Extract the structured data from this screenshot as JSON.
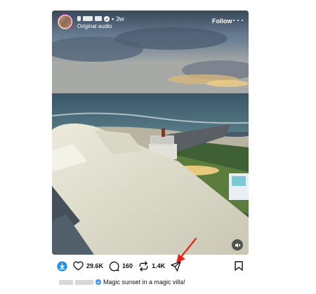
{
  "post": {
    "header": {
      "time_ago": "3w",
      "dot": "•",
      "audio": "Original audio",
      "follow": "Follow"
    },
    "actions": {
      "likes": "29.6K",
      "comments": "160",
      "reposts": "1.4K"
    },
    "caption": {
      "text": "Magic sunset in a magic villa!"
    }
  },
  "colors": {
    "verified": "#3897f0",
    "annotation_arrow": "#e8221b",
    "download_button": "#1e8fe6"
  },
  "icons": [
    "avatar",
    "verified-icon",
    "more-icon",
    "speaker-mute-icon",
    "download-icon",
    "heart-icon",
    "comment-icon",
    "repost-icon",
    "share-icon",
    "bookmark-icon"
  ]
}
